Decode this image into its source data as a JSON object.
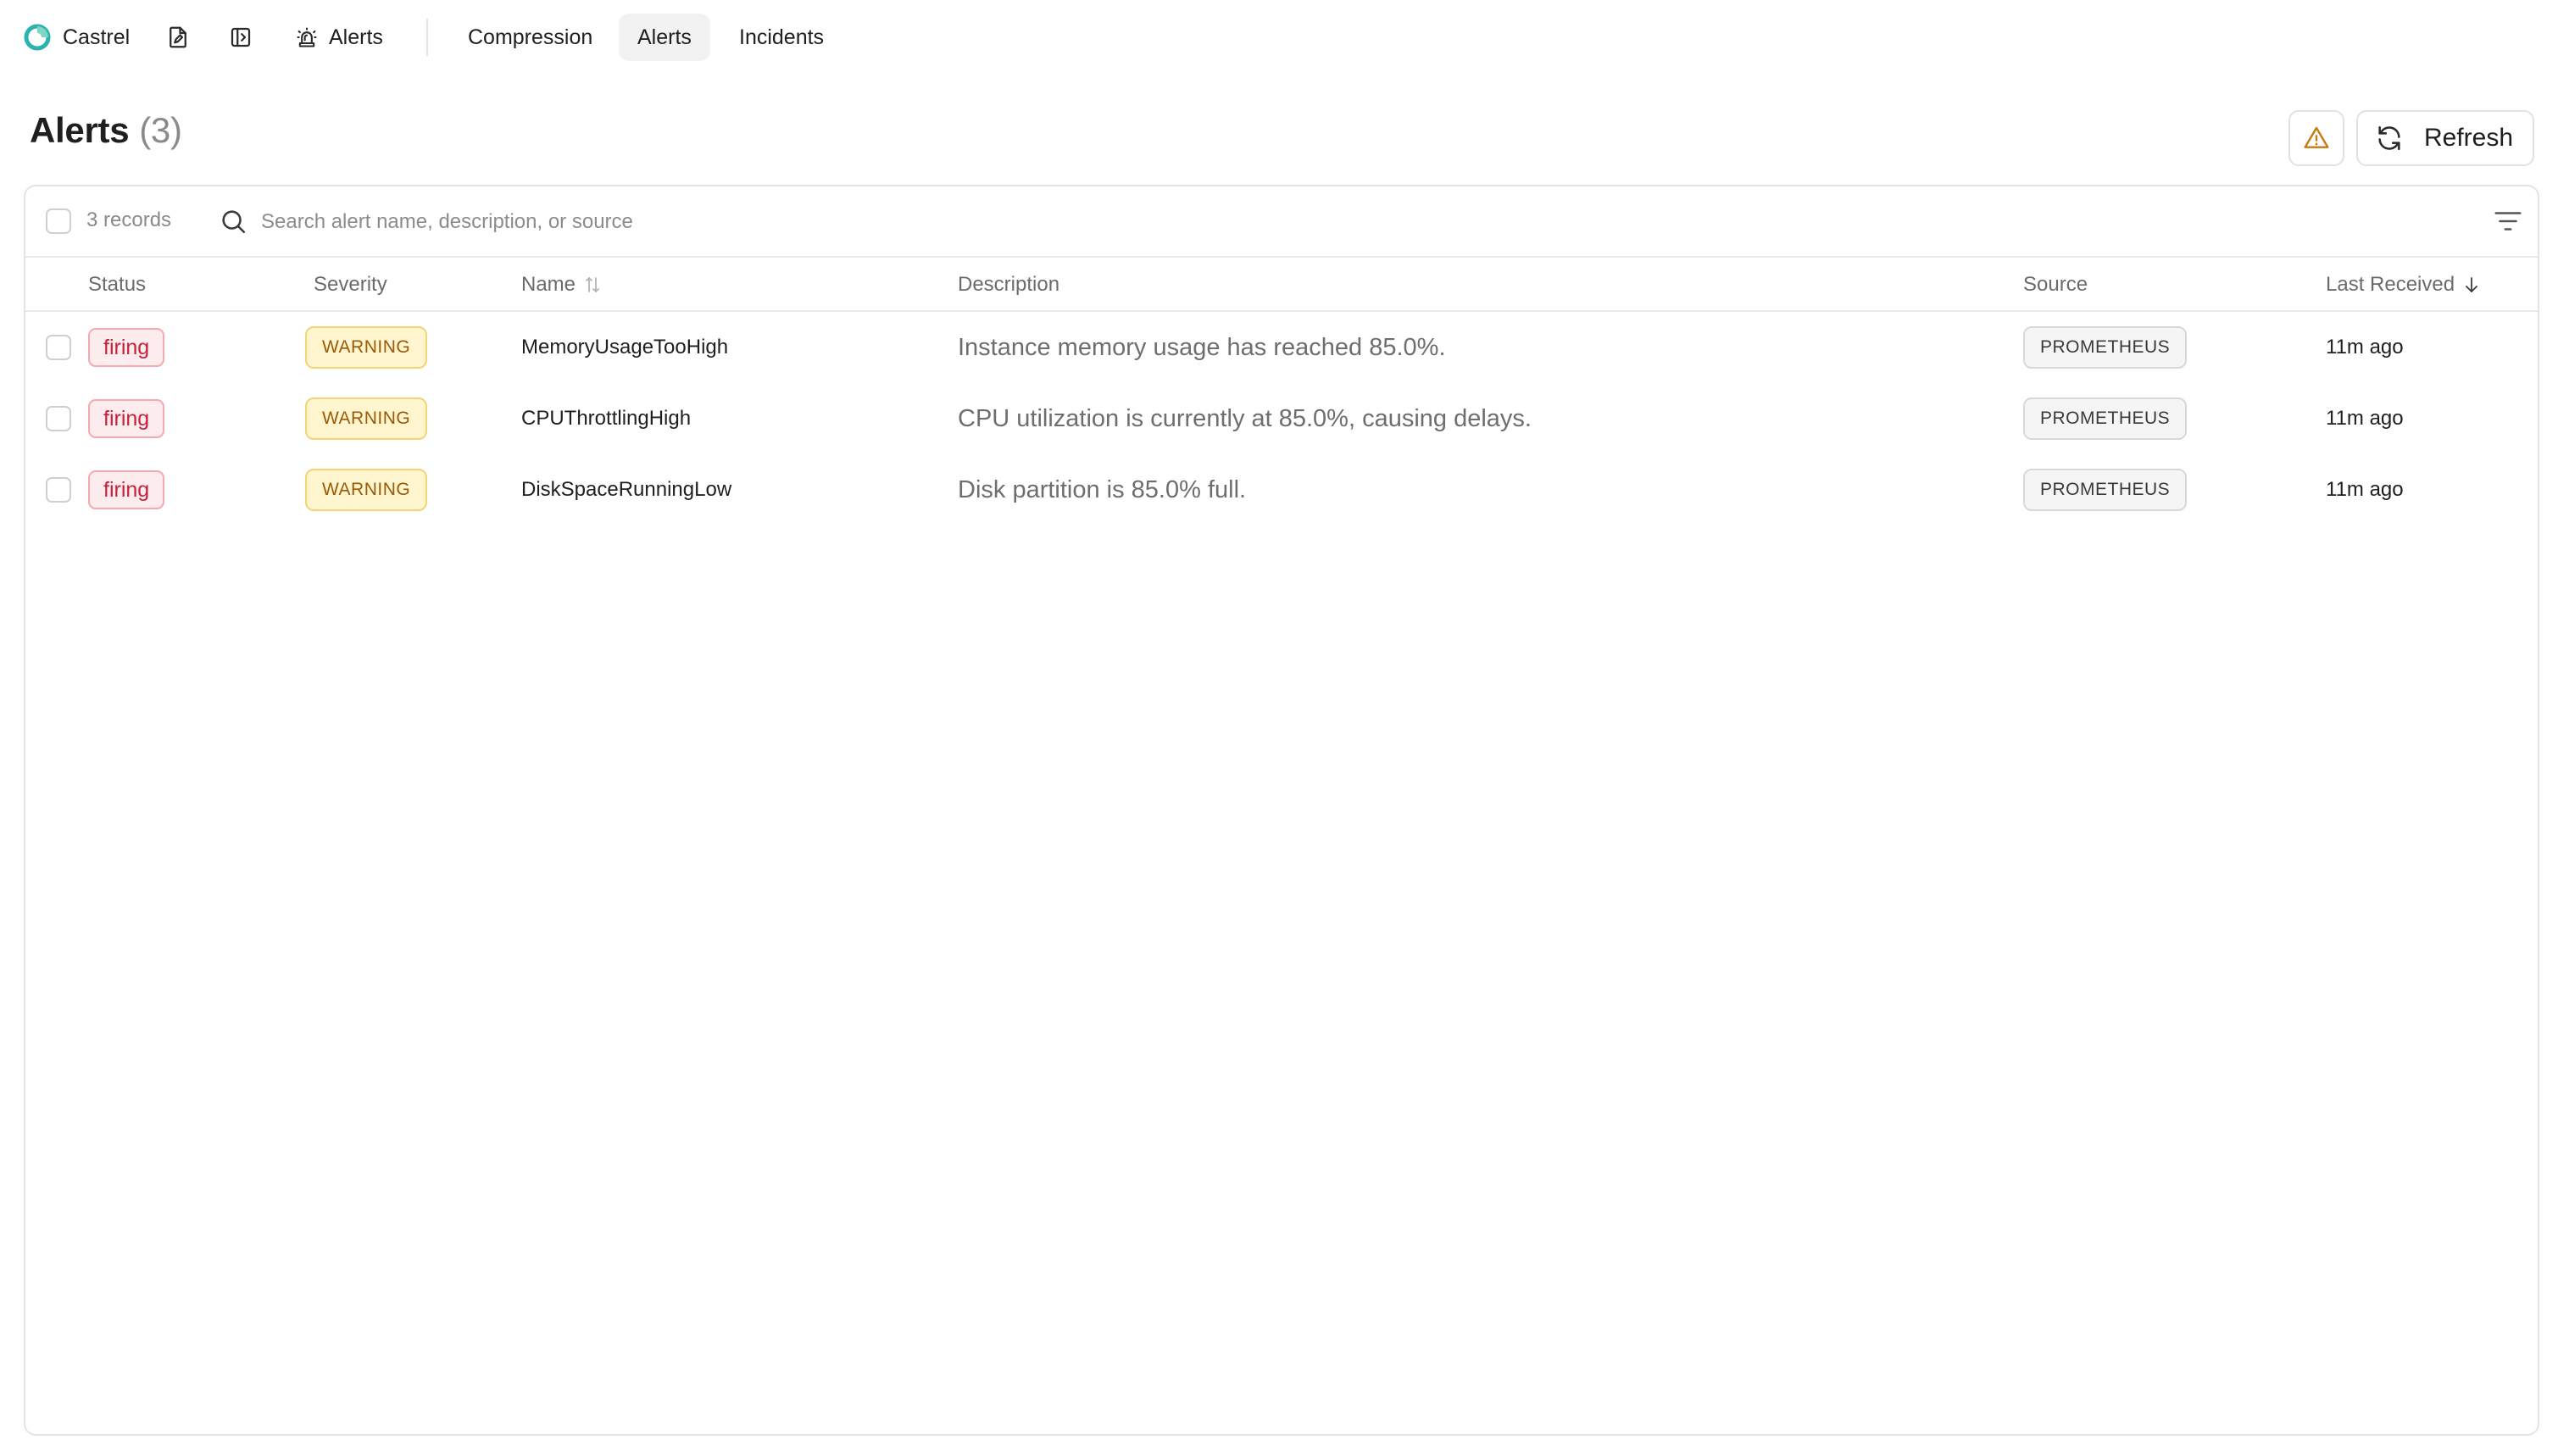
{
  "brand": {
    "name": "Castrel"
  },
  "nav": {
    "alerts_link": "Alerts",
    "tabs": [
      {
        "label": "Compression",
        "active": false
      },
      {
        "label": "Alerts",
        "active": true
      },
      {
        "label": "Incidents",
        "active": false
      }
    ]
  },
  "header": {
    "title": "Alerts",
    "count": "(3)",
    "refresh_label": "Refresh"
  },
  "toolbar": {
    "records_count": "3 records",
    "search_placeholder": "Search alert name, description, or source",
    "search_value": ""
  },
  "table": {
    "columns": {
      "status": "Status",
      "severity": "Severity",
      "name": "Name",
      "description": "Description",
      "source": "Source",
      "last_received": "Last Received"
    },
    "rows": [
      {
        "status": "firing",
        "severity": "WARNING",
        "name": "MemoryUsageTooHigh",
        "description": "Instance memory usage has reached 85.0%.",
        "source": "PROMETHEUS",
        "last_received": "11m ago"
      },
      {
        "status": "firing",
        "severity": "WARNING",
        "name": "CPUThrottlingHigh",
        "description": "CPU utilization is currently at 85.0%, causing delays.",
        "source": "PROMETHEUS",
        "last_received": "11m ago"
      },
      {
        "status": "firing",
        "severity": "WARNING",
        "name": "DiskSpaceRunningLow",
        "description": "Disk partition is 85.0% full.",
        "source": "PROMETHEUS",
        "last_received": "11m ago"
      }
    ]
  },
  "colors": {
    "firing_text": "#c4213a",
    "warning_text": "#9a5a06",
    "warning_bg": "#fff5cf",
    "brand_teal": "#20b2aa"
  }
}
